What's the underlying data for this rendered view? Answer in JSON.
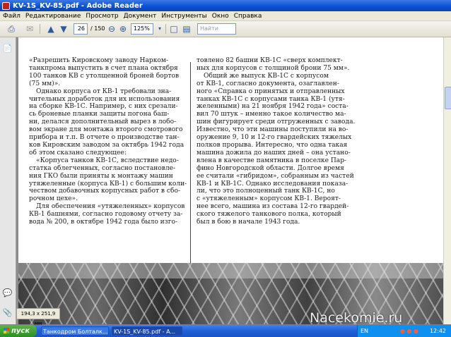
{
  "window": {
    "title": "KV-1S_KV-85.pdf - Adobe Reader"
  },
  "menu": [
    "Файл",
    "Редактирование",
    "Просмотр",
    "Документ",
    "Инструменты",
    "Окно",
    "Справка"
  ],
  "toolbar": {
    "current_page": "26",
    "page_sep": "/ 150",
    "zoom": "125%",
    "search_placeholder": "Найти"
  },
  "icons": {
    "print": "print-icon",
    "email": "email-icon",
    "prev": "page-up-icon",
    "next": "page-down-icon",
    "zoom_out": "zoom-out-icon",
    "zoom_in": "zoom-in-icon",
    "fit": "fit-page-icon"
  },
  "document": {
    "left_column": [
      "«Разрешить Кировскому заводу Нарком-\nтанкпрома выпустить в счет плана октября\n100 танков КВ с утолщенной броней бортов\n(75 мм)».",
      "Однако корпуса от КВ-1 требовали зна-\nчительных доработок для их использования\nна сборке КВ-1С. Например, с них срезали-\nсь броневые планки защиты погона баш-\nни, делался дополнительный вырез в лобо-\nвом экране для монтажа второго смотрового\nприбора и т.п. В отчете о производстве тан-\nков Кировским заводом за октябрь 1942 года\nоб этом сказано следующее:",
      "«Корпуса танков КВ-1С, вследствие недо-\nстатка облегченных, согласно постановле-\nния ГКО были приняты к монтажу машин\nутяжеленные (корпуса КВ-1) с большим коли-\nчеством добавочных корпусных работ в сбо-\nрочном цехе».",
      "Для обеспечения «утяжеленных» корпусов\nКВ-1 башнями, согласно годовому отчету за-\nвода № 200, в октябре 1942 года было изго-"
    ],
    "right_column": [
      "товлено 82 башни КВ-1С «сверх комплект-\nных для корпусов с толщиной брони 75 мм».",
      "Общий же выпуск КВ-1С с корпусом\nот КВ-1, согласно документа, озаглавлен-\nного «Справка о принятых и отправленных\nтанках КВ-1С с корпусами танка КВ-1 (утя-\nжеленными) на 21 ноября 1942 года» соста-\nвил 70 штук – именно такое количество ма-\nшин фигурирует среди отгруженных с завода.\nИзвестно, что эти машины поступили на во-\nоружение 9, 10 и 12-го гвардейских тяжелых\nполков прорыва. Интересно, что одна такая\nмашина дожила до наших дней – она устано-\nвлена в качестве памятника в поселке Пар-\nфино Новгородской области. Долгое время\nее считали «гибридом», собранным из частей\nКВ-1 и КВ-1С. Однако исследования показа-\nли, что это полноценный танк КВ-1С, но\nс «утяжеленным» корпусом КВ-1. Вероят-\nнее всего, машина из состава 12-го гвардей-\nского тяжелого танкового полка, который\nбыл в бою в начале 1943 года."
    ]
  },
  "status": {
    "page_size": "194,3 x 251,9 мм"
  },
  "taskbar": {
    "start_label": "пуск",
    "tasks": [
      "Танкодром Болталк...",
      "KV-1S_KV-85.pdf - A..."
    ],
    "language": "EN",
    "clock": "12:42"
  },
  "watermark": "Nacekomie.ru"
}
